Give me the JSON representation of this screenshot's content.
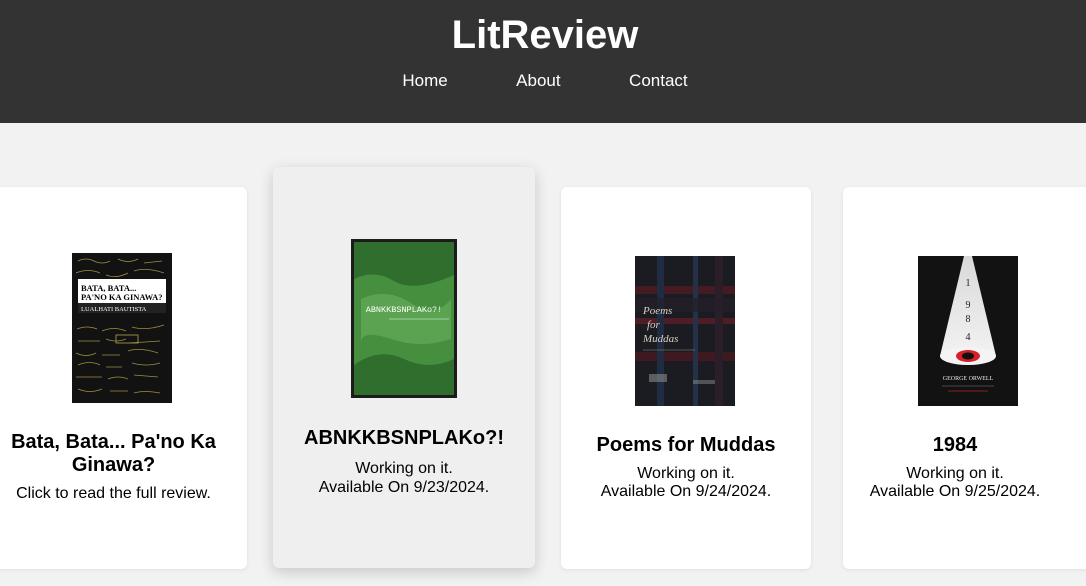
{
  "header": {
    "title": "LitReview",
    "nav": [
      "Home",
      "About",
      "Contact"
    ]
  },
  "cards": [
    {
      "title": "Bata, Bata... Pa'no Ka Ginawa?",
      "line1": "Click to read the full review.",
      "line2": "",
      "cover": {
        "title_line1": "BATA, BATA...",
        "title_line2": "PA'NO KA GINAWA?",
        "author": "LUALHATI BAUTISTA"
      }
    },
    {
      "title": "ABNKKBSNPLAKo?!",
      "line1": "Working on it.",
      "line2": "Available On 9/23/2024.",
      "cover": {
        "title": "ABNKKBSNPLAKo?!"
      }
    },
    {
      "title": "Poems for Muddas",
      "line1": "Working on it.",
      "line2": "Available On 9/24/2024.",
      "cover": {
        "title_line1": "Poems",
        "title_line2": "for",
        "title_line3": "Muddas"
      }
    },
    {
      "title": "1984",
      "line1": "Working on it.",
      "line2": "Available On 9/25/2024.",
      "cover": {
        "digits": [
          "1",
          "9",
          "8",
          "4"
        ],
        "author": "GEORGE ORWELL"
      }
    }
  ],
  "colors": {
    "header_bg": "#333333",
    "page_bg": "#f2f2f2",
    "card_bg": "#ffffff",
    "card_active_bg": "#efefef"
  }
}
